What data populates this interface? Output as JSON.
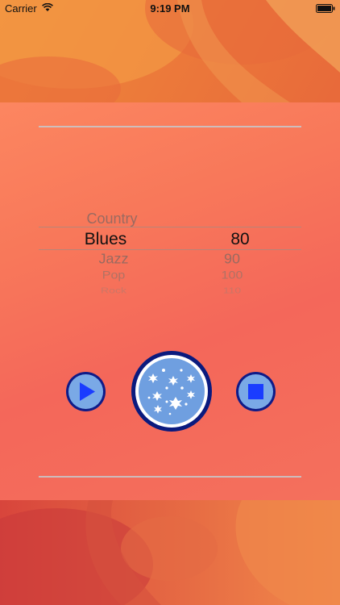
{
  "status_bar": {
    "carrier": "Carrier",
    "time": "9:19 PM"
  },
  "picker": {
    "genres": [
      {
        "label": "Country",
        "state": "above"
      },
      {
        "label": "Blues",
        "state": "selected"
      },
      {
        "label": "Jazz",
        "state": "below"
      },
      {
        "label": "Pop",
        "state": "below"
      },
      {
        "label": "Rock",
        "state": "below"
      }
    ],
    "tempos": [
      {
        "label": "80",
        "state": "selected"
      },
      {
        "label": "90",
        "state": "below"
      },
      {
        "label": "100",
        "state": "below"
      },
      {
        "label": "110",
        "state": "below"
      }
    ]
  },
  "controls": {
    "play_icon": "play-icon",
    "main_icon": "sparkle-burst-icon",
    "stop_icon": "stop-icon"
  },
  "colors": {
    "button_navy": "#0f1b88",
    "button_fill": "#7aa9e6",
    "icon_blue": "#1a3cff",
    "panel_coral": "#f8785a"
  }
}
